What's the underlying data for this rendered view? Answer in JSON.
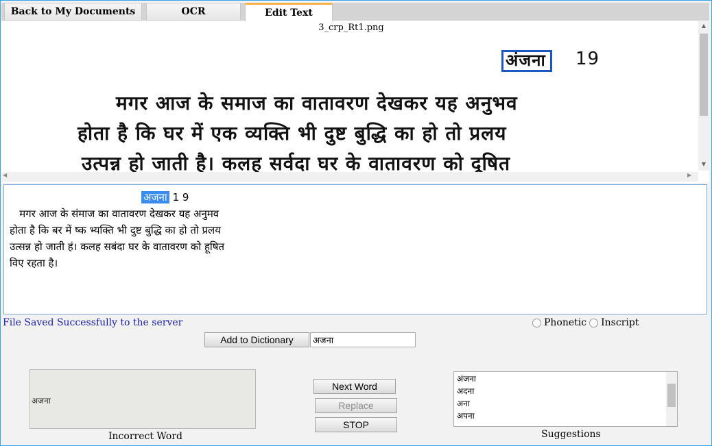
{
  "tabs": [
    {
      "label": "Back to My Documents"
    },
    {
      "label": "OCR"
    },
    {
      "label": "Edit Text"
    }
  ],
  "image_viewer": {
    "filename": "3_crp_Rt1.png",
    "heading_word": "अंजना",
    "page_number": "19",
    "lines": [
      "मगर आज के समाज का  वातावरण  देखकर  यह अनुभव",
      "होता है कि घर में एक व्यक्ति भी  दुष्ट  बुद्धि का हो  तो प्रलय",
      "उत्पन्न हो जाती है। कलह सर्वदा घर  के वातावरण  को दूषित"
    ]
  },
  "editor": {
    "selected_word": "अजना",
    "page_number": " 1 9",
    "text": "   मगर आज के संमाज का वातावरण देखकर यह अनुमव\nहोता है कि बर में ष्क भ्यक्ति भी दुष्ट बुद्धि का हो तो प्रलय\nउत्सन्न हो जाती हं। कलह सबंदा घर के वातावरण को हूषित\nविए रहता है।"
  },
  "status": {
    "message": "File Saved Successfully to the server"
  },
  "keyboard": {
    "phonetic_label": "Phonetic",
    "inscript_label": "Inscript"
  },
  "dictionary": {
    "button_label": "Add to Dictionary",
    "input_value": "अजना"
  },
  "incorrect_word": {
    "value": "अजना",
    "caption": "Incorrect Word"
  },
  "actions": {
    "next_label": "Next Word",
    "replace_label": "Replace",
    "stop_label": "STOP"
  },
  "suggestions": {
    "items": [
      "अंजना",
      "अदना",
      "अना",
      "अपना"
    ],
    "caption": "Suggestions"
  }
}
